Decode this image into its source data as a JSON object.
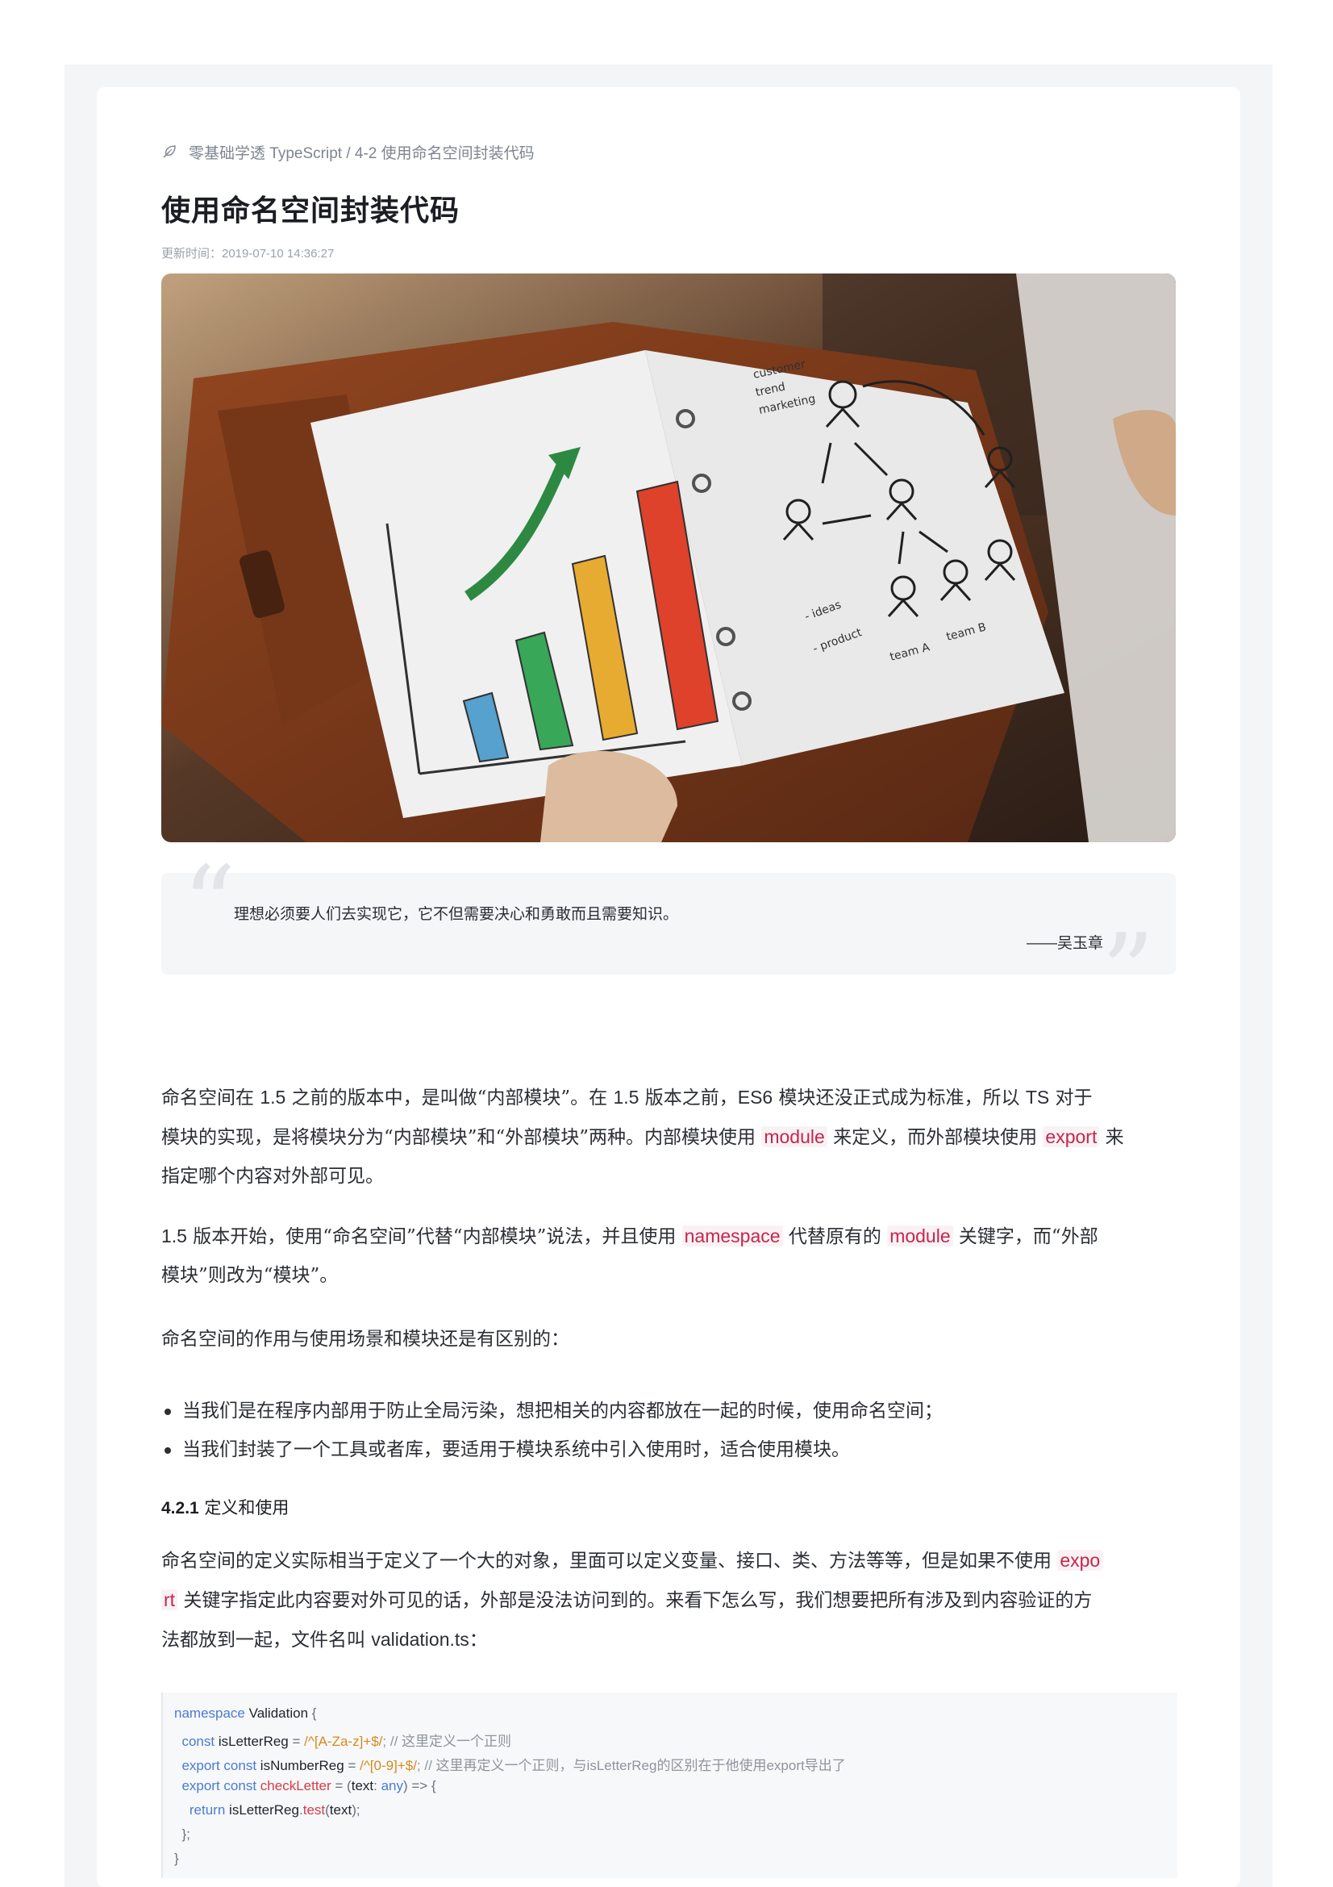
{
  "breadcrumb": {
    "icon": "leaf-icon",
    "text": "零基础学透 TypeScript / 4-2 使用命名空间封装代码"
  },
  "article": {
    "title": "使用命名空间封装代码",
    "updated": "更新时间：2019-07-10 14:36:27"
  },
  "quote": {
    "text": "理想必须要人们去实现它，它不但需要决心和勇敢而且需要知识。",
    "author": "——吴玉章"
  },
  "para1": {
    "l1a": "命名空间在 ",
    "l1b": "1.5",
    "l1c": " 之前的版本中，是叫做“内部模块”。在 ",
    "l1d": "1.5",
    "l1e": " 版本之前，",
    "l1f": "ES6",
    "l1g": " 模块还没正式成为标准，所以 ",
    "l1h": "TS",
    "l1i": " 对于",
    "l2a": "模块的实现，是将模块分为“内部模块”和“外部模块”两种。内部模块使用 ",
    "l2code1": "module",
    "l2b": " 来定义，而外部模块使用 ",
    "l2code2": "export",
    "l2c": " 来",
    "l3": "指定哪个内容对外部可见。"
  },
  "para2": {
    "l1a": "1.5",
    "l1b": " 版本开始，使用“命名空间”代替“内部模块”说法，并且使用 ",
    "l1code1": "namespace",
    "l1c": " 代替原有的 ",
    "l1code2": "module",
    "l1d": " 关键字，而“外部",
    "l2": "模块”则改为“模块”。"
  },
  "para3": "命名空间的作用与使用场景和模块还是有区别的：",
  "bullets": [
    "当我们是在程序内部用于防止全局污染，想把相关的内容都放在一起的时候，使用命名空间；",
    "当我们封装了一个工具或者库，要适用于模块系统中引入使用时，适合使用模块。"
  ],
  "subhead": {
    "num": "4.2.1",
    "text": " 定义和使用"
  },
  "para4": {
    "l1a": "命名空间的定义实际相当于定义了一个大的对象，里面可以定义变量、接口、类、方法等等，但是如果不使用 ",
    "l1code": "expo",
    "l2code": "rt",
    "l2a": " 关键字指定此内容要对外可见的话，外部是没法访问到的。来看下怎么写，我们想要把所有涉及到内容验证的方",
    "l3a": "法都放到一起，文件名叫 ",
    "l3b": "validation.ts",
    "l3c": "："
  },
  "code": {
    "l1a": "namespace",
    "l1b": " Validation",
    "l1c": " {",
    "l2a": "  const",
    "l2b": " isLetterReg",
    "l2c": " = ",
    "l2d": "/^[A-Za-z]+$/",
    "l2e": "; // 这里定义一个正则",
    "l3a": "  export const",
    "l3b": " isNumberReg",
    "l3c": " = ",
    "l3d": "/^[0-9]+$/",
    "l3e": "; // 这里再定义一个正则，与isLetterReg的区别在于他使用export导出了",
    "l4a": "  export const",
    "l4b": " checkLetter",
    "l4c": " = (",
    "l4d": "text",
    "l4e": ": ",
    "l4f": "any",
    "l4g": ") => {",
    "l5a": "    return",
    "l5b": " isLetterReg",
    "l5c": ".",
    "l5d": "test",
    "l5e": "(",
    "l5f": "text",
    "l5g": ");",
    "l6": "  };",
    "l7": "}"
  },
  "hero_image": {
    "alt_icons": [
      "notebook-photo"
    ]
  }
}
